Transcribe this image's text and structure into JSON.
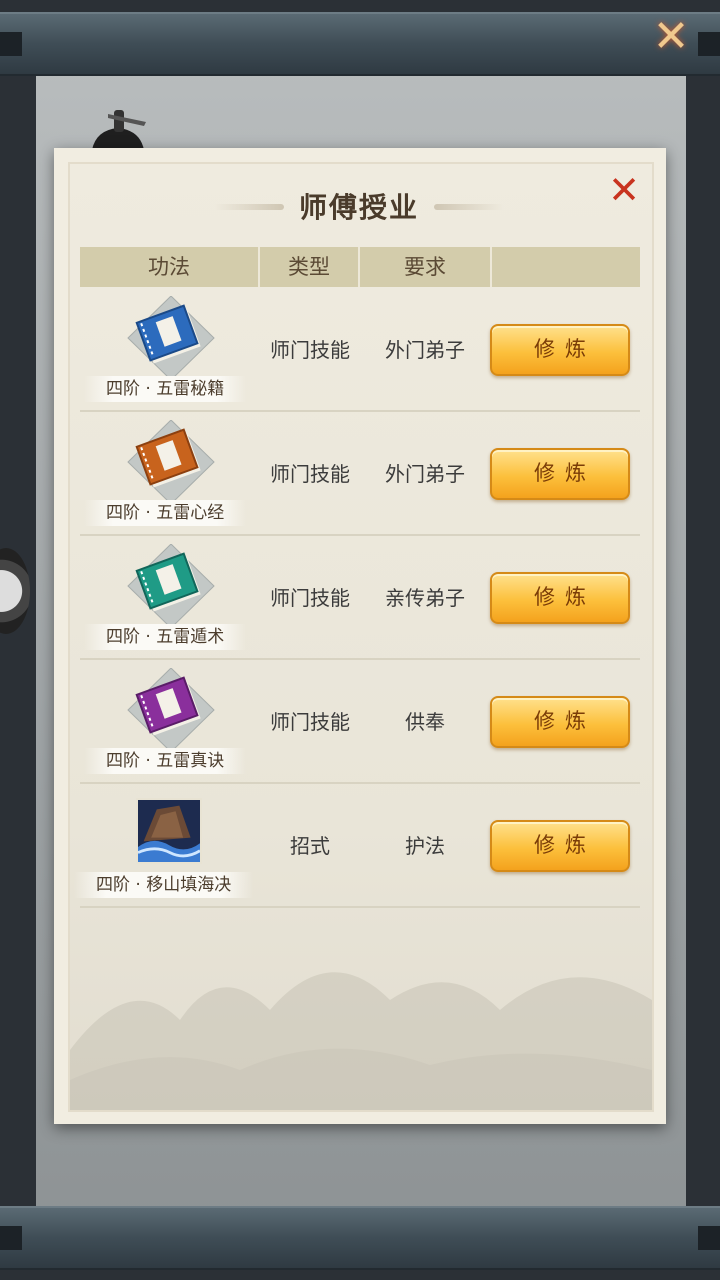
{
  "panel": {
    "title": "师傅授业"
  },
  "table": {
    "headers": [
      "功法",
      "类型",
      "要求",
      ""
    ],
    "rows": [
      {
        "name": "四阶 · 五雷秘籍",
        "type": "师门技能",
        "requirement": "外门弟子",
        "button": "修炼",
        "icon": "blue-book-icon",
        "color": "#2c6bbd"
      },
      {
        "name": "四阶 · 五雷心经",
        "type": "师门技能",
        "requirement": "外门弟子",
        "button": "修炼",
        "icon": "orange-book-icon",
        "color": "#c8631d"
      },
      {
        "name": "四阶 · 五雷遁术",
        "type": "师门技能",
        "requirement": "亲传弟子",
        "button": "修炼",
        "icon": "teal-book-icon",
        "color": "#1f9b86"
      },
      {
        "name": "四阶 · 五雷真诀",
        "type": "师门技能",
        "requirement": "供奉",
        "button": "修炼",
        "icon": "purple-book-icon",
        "color": "#8a2f9c"
      },
      {
        "name": "四阶 · 移山填海决",
        "type": "招式",
        "requirement": "护法",
        "button": "修炼",
        "icon": "mountain-sea-skill-icon",
        "color": "#2d3f6b"
      }
    ]
  }
}
